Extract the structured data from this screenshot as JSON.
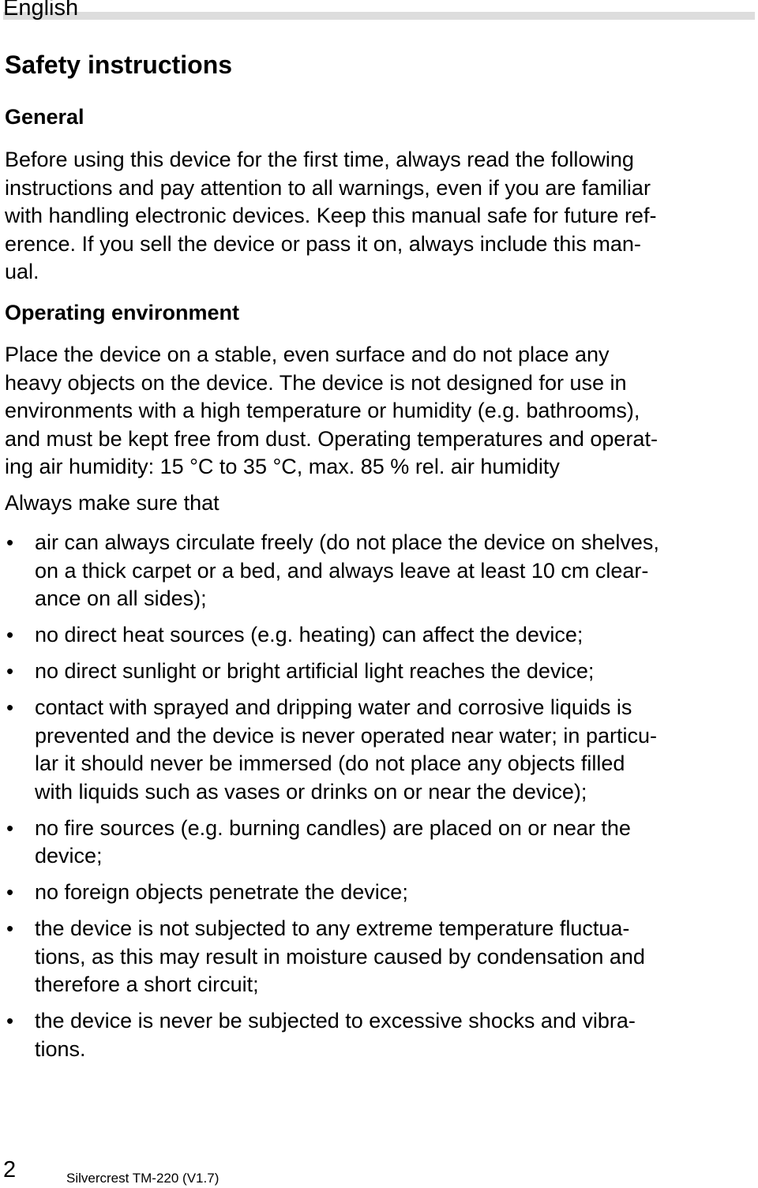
{
  "header": {
    "language": "English"
  },
  "title": "Safety instructions",
  "sections": {
    "general": {
      "heading": "General",
      "text": "Before using this device for the first time, always read the following\ninstructions and pay attention to all warnings, even if you are familiar\nwith handling electronic devices. Keep this manual safe for future ref-\nerence. If you sell the device or pass it on, always include this man-\nual."
    },
    "operating_environment": {
      "heading": "Operating environment",
      "text": "Place the device on a stable, even surface and do not place any\nheavy objects on the device. The device is not designed for use in\nenvironments with a high temperature or humidity (e.g. bathrooms),\nand must be kept free from dust. Operating temperatures and operat-\ning air humidity: 15 °C to 35 °C, max. 85 % rel. air humidity",
      "intro": "Always make sure that",
      "bullets": [
        "air can always circulate freely (do not place the device on shelves,\non a thick carpet or a bed, and always leave at least 10 cm clear-\nance on all sides);",
        "no direct heat sources (e.g. heating) can affect the device;",
        "no direct sunlight or bright artificial light reaches the device;",
        "contact with sprayed and dripping water and corrosive liquids is\nprevented and the device is never operated near water; in particu-\nlar it should never be immersed (do not place any objects filled\nwith liquids such as vases or drinks on or near the device);",
        "no fire sources (e.g. burning candles) are placed on or near the\ndevice;",
        "no foreign objects penetrate the device;",
        "the device is not subjected to any extreme temperature fluctua-\ntions, as this may result in moisture caused by condensation and\ntherefore a short circuit;",
        "the device is never be subjected to excessive shocks and vibra-\ntions."
      ]
    }
  },
  "footer": {
    "page_number": "2",
    "model": "Silvercrest TM-220 (V1.7)"
  },
  "bullet_glyph": "•"
}
